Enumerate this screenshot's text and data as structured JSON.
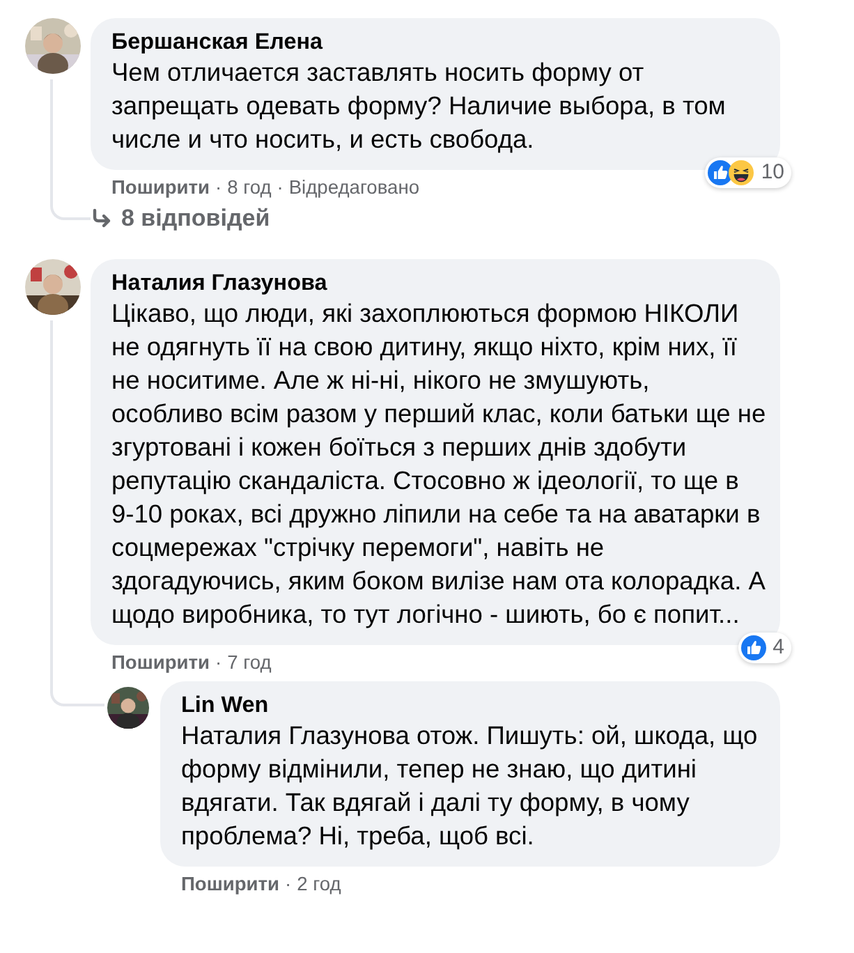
{
  "comments": [
    {
      "author": "Бершанская Елена",
      "text": "Чем отличается заставлять носить форму от запрещать одевать форму? Наличие выбора, в том числе и что носить, и есть свобода.",
      "actions": [
        {
          "kind": "share",
          "text": "Поширити"
        },
        {
          "kind": "dot",
          "text": "·"
        },
        {
          "kind": "time",
          "text": "8 год"
        },
        {
          "kind": "dot",
          "text": "·"
        },
        {
          "kind": "edited",
          "text": "Відредаговано"
        }
      ],
      "reactions": {
        "icons": [
          {
            "kind": "like"
          },
          {
            "kind": "haha"
          }
        ],
        "count": "10"
      },
      "replies_link": "8 відповідей"
    },
    {
      "author": "Наталия Глазунова",
      "text": "Цікаво, що люди, які захоплюються формою НІКОЛИ не одягнуть її на свою дитину, якщо ніхто, крім них, її не носитиме. Але ж ні-ні, нікого не змушують, особливо всім разом у перший клас, коли батьки ще не згуртовані і кожен боїться з перших днів здобути репутацію скандаліста. Стосовно ж ідеології, то ще в 9-10 роках, всі дружно ліпили на себе та на аватарки в соцмережах \"стрічку перемоги\", навіть не здогадуючись, яким боком вилізе нам ота колорадка. А щодо виробника, то тут логічно - шиють, бо є попит...",
      "actions": [
        {
          "kind": "share",
          "text": "Поширити"
        },
        {
          "kind": "dot",
          "text": "·"
        },
        {
          "kind": "time",
          "text": "7 год"
        }
      ],
      "reactions": {
        "icons": [
          {
            "kind": "like"
          }
        ],
        "count": "4"
      },
      "replies": [
        {
          "author": "Lin Wen",
          "text": "Наталия Глазунова отож. Пишуть: ой, шкода, що форму відмінили, тепер не знаю, що дитині вдягати. Так вдягай і далі ту форму, в чому проблема? Ні, треба, щоб всі.",
          "actions": [
            {
              "kind": "share",
              "text": "Поширити"
            },
            {
              "kind": "dot",
              "text": "·"
            },
            {
              "kind": "time",
              "text": "2 год"
            }
          ]
        }
      ]
    }
  ]
}
